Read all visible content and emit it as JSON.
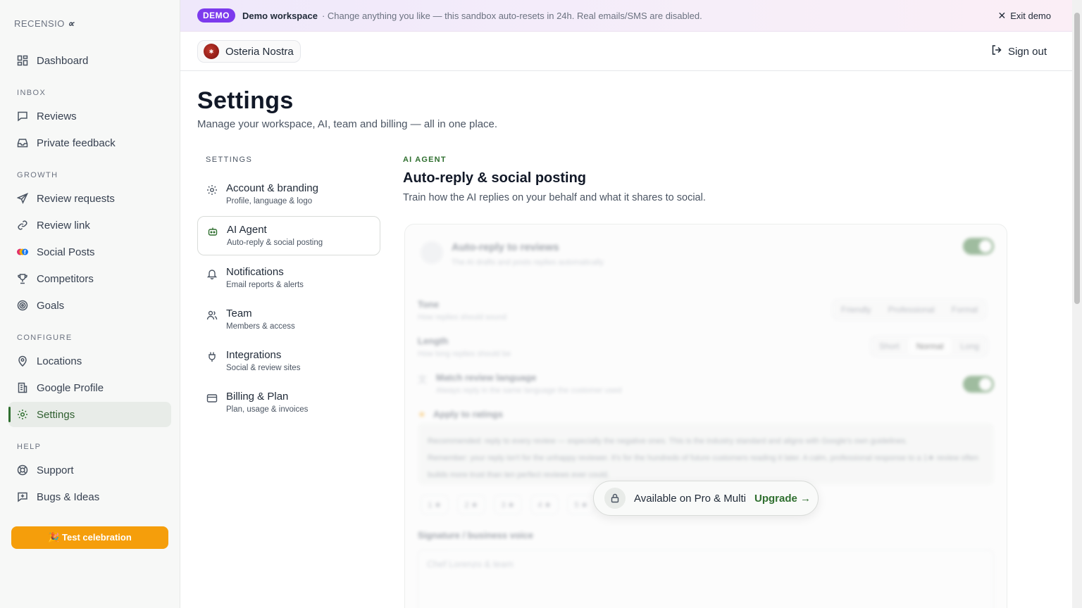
{
  "brand": {
    "logo_text": "RECENSIO",
    "logo_mark": "∝"
  },
  "banner": {
    "badge": "DEMO",
    "workspace": "Demo workspace",
    "message": "· Change anything you like — this sandbox auto-resets in 24h. Real emails/SMS are disabled.",
    "exit_label": "Exit demo"
  },
  "topbar": {
    "org_name": "Osteria Nostra",
    "signout_label": "Sign out"
  },
  "sidebar": {
    "dashboard": "Dashboard",
    "sections": {
      "inbox": "INBOX",
      "growth": "GROWTH",
      "configure": "CONFIGURE",
      "help": "HELP"
    },
    "items": {
      "reviews": "Reviews",
      "private_feedback": "Private feedback",
      "review_requests": "Review requests",
      "review_link": "Review link",
      "social_posts": "Social Posts",
      "competitors": "Competitors",
      "goals": "Goals",
      "locations": "Locations",
      "google_profile": "Google Profile",
      "settings": "Settings",
      "support": "Support",
      "bugs_ideas": "Bugs & Ideas"
    },
    "celebration_button": "🎉 Test celebration"
  },
  "page": {
    "title": "Settings",
    "subtitle": "Manage your workspace, AI, team and billing — all in one place."
  },
  "settings_nav": {
    "label": "SETTINGS",
    "items": [
      {
        "title": "Account & branding",
        "desc": "Profile, language & logo"
      },
      {
        "title": "AI Agent",
        "desc": "Auto-reply & social posting"
      },
      {
        "title": "Notifications",
        "desc": "Email reports & alerts"
      },
      {
        "title": "Team",
        "desc": "Members & access"
      },
      {
        "title": "Integrations",
        "desc": "Social & review sites"
      },
      {
        "title": "Billing & Plan",
        "desc": "Plan, usage & invoices"
      }
    ]
  },
  "section": {
    "eyebrow": "AI AGENT",
    "title": "Auto-reply & social posting",
    "desc": "Train how the AI replies on your behalf and what it shares to social."
  },
  "locked_card": {
    "auto_reply_title": "Auto-reply to reviews",
    "auto_reply_desc": "The AI drafts and posts replies automatically",
    "tone_label": "Tone",
    "tone_desc": "How replies should sound",
    "tone_options": [
      "Friendly",
      "Professional",
      "Formal"
    ],
    "length_label": "Length",
    "length_desc": "How long replies should be",
    "length_options": [
      "Short",
      "Normal",
      "Long"
    ],
    "match_lang_title": "Match review language",
    "match_lang_desc": "Always reply in the same language the customer used",
    "apply_ratings": "Apply to ratings",
    "note_line1": "Recommended: reply to every review — especially the negative ones. This is the industry standard and aligns with Google's own guidelines.",
    "note_line2": "Remember: your reply isn't for the unhappy reviewer. It's for the hundreds of future customers reading it later. A calm, professional response to a 1★ review often builds more trust than ten perfect reviews ever could.",
    "rating_pills": [
      "1 ★",
      "2 ★",
      "3 ★",
      "4 ★",
      "5 ★"
    ],
    "signature_label": "Signature / business voice",
    "signature_placeholder": "Chef Lorenzo & team"
  },
  "upgrade": {
    "text": "Available on Pro & Multi",
    "cta": "Upgrade →"
  }
}
